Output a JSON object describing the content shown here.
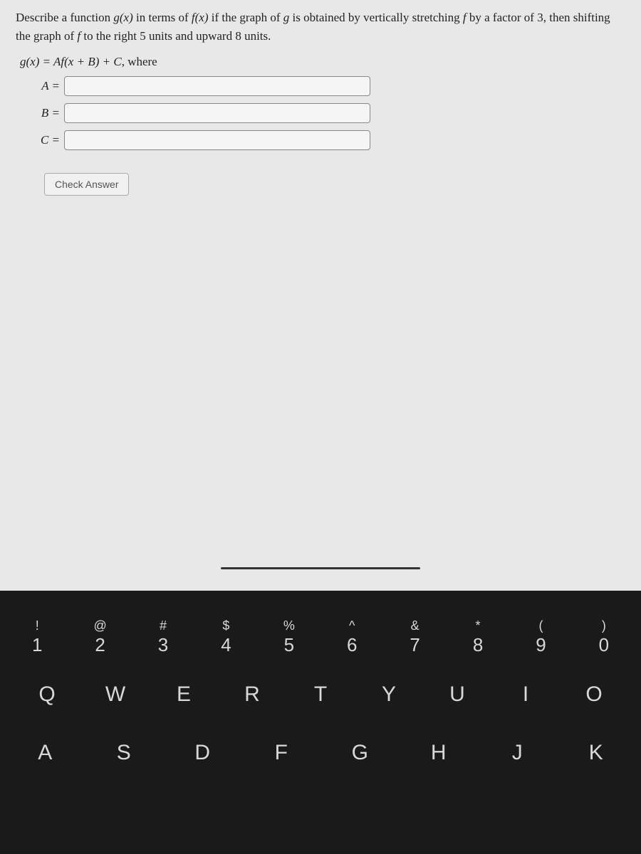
{
  "problem": {
    "text_pre": "Describe a function ",
    "gx": "g(x)",
    "text_mid1": " in terms of ",
    "fx": "f(x)",
    "text_mid2": " if the graph of ",
    "g": "g",
    "text_mid3": " is obtained by vertically stretching ",
    "f": "f",
    "text_mid4": " by a factor of 3, then shifting the graph of ",
    "f2": "f",
    "text_end": " to the right 5 units and upward 8 units."
  },
  "equation": {
    "lhs": "g(x) = Af(x + B) + C",
    "suffix": ", where"
  },
  "inputs": {
    "A": {
      "label": "A =",
      "value": ""
    },
    "B": {
      "label": "B =",
      "value": ""
    },
    "C": {
      "label": "C =",
      "value": ""
    }
  },
  "check_button": "Check Answer",
  "keyboard": {
    "row1": [
      {
        "top": "!",
        "bottom": "1"
      },
      {
        "top": "@",
        "bottom": "2"
      },
      {
        "top": "#",
        "bottom": "3"
      },
      {
        "top": "$",
        "bottom": "4"
      },
      {
        "top": "%",
        "bottom": "5"
      },
      {
        "top": "^",
        "bottom": "6"
      },
      {
        "top": "&",
        "bottom": "7"
      },
      {
        "top": "*",
        "bottom": "8"
      },
      {
        "top": "(",
        "bottom": "9"
      },
      {
        "top": ")",
        "bottom": "0"
      }
    ],
    "row2": [
      "Q",
      "W",
      "E",
      "R",
      "T",
      "Y",
      "U",
      "I",
      "O"
    ],
    "row3": [
      "A",
      "S",
      "D",
      "F",
      "G",
      "H",
      "J",
      "K"
    ]
  }
}
